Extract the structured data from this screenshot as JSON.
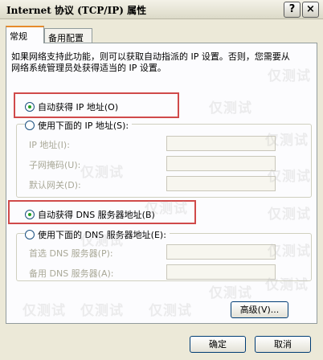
{
  "window": {
    "title": "Internet 协议 (TCP/IP) 属性",
    "help_label": "?",
    "close_label": "×"
  },
  "tabs": [
    {
      "label": "常规",
      "active": true
    },
    {
      "label": "备用配置",
      "active": false
    }
  ],
  "description": "如果网络支持此功能，则可以获取自动指派的 IP 设置。否则，您需要从网络系统管理员处获得适当的 IP 设置。",
  "ip_section": {
    "auto_label": "自动获得 IP 地址(O)",
    "auto_selected": true,
    "manual_label": "使用下面的 IP 地址(S):",
    "fields": [
      {
        "label": "IP 地址(I):",
        "value": ""
      },
      {
        "label": "子网掩码(U):",
        "value": ""
      },
      {
        "label": "默认网关(D):",
        "value": ""
      }
    ]
  },
  "dns_section": {
    "auto_label": "自动获得 DNS 服务器地址(B)",
    "auto_selected": true,
    "manual_label": "使用下面的 DNS 服务器地址(E):",
    "fields": [
      {
        "label": "首选 DNS 服务器(P):",
        "value": ""
      },
      {
        "label": "备用 DNS 服务器(A):",
        "value": ""
      }
    ]
  },
  "buttons": {
    "advanced": "高级(V)...",
    "ok": "确定",
    "cancel": "取消"
  },
  "watermark": "仅测试",
  "colors": {
    "highlight": "#d04a4a",
    "tab_accent": "#e68b2c",
    "radio_dot": "#21a121"
  }
}
